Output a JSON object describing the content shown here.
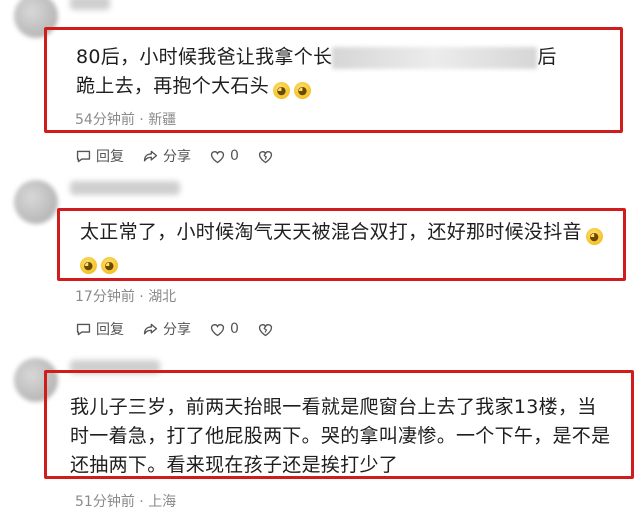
{
  "comments": [
    {
      "text_line1_a": "80后，小时候我爸让我拿个长",
      "text_line1_b": "后",
      "text_line2": "跪上去，再抱个大石头",
      "meta_time": "54分钟前",
      "meta_sep": "·",
      "meta_location": "新疆",
      "reply_label": "回复",
      "share_label": "分享",
      "like_count": "0"
    },
    {
      "text_line1": "太正常了，小时候淘气天天被混合双打，还好那时候没抖音",
      "meta_time": "17分钟前",
      "meta_sep": "·",
      "meta_location": "湖北",
      "reply_label": "回复",
      "share_label": "分享",
      "like_count": "0"
    },
    {
      "text_line1": "我儿子三岁，前两天抬眼一看就是爬窗台上去了我家13楼，当",
      "text_line2": "时一着急，打了他屁股两下。哭的拿叫凄惨。一个下午，是不是",
      "text_line3": "还抽两下。看来现在孩子还是挨打少了",
      "meta_time": "51分钟前",
      "meta_sep": "·",
      "meta_location": "上海"
    }
  ],
  "colors": {
    "highlight_box": "#d01c1c",
    "meta": "#8a8a8a"
  },
  "icons": [
    "comment-icon",
    "share-icon",
    "heart-icon",
    "broken-heart-icon",
    "emoji-icon"
  ]
}
